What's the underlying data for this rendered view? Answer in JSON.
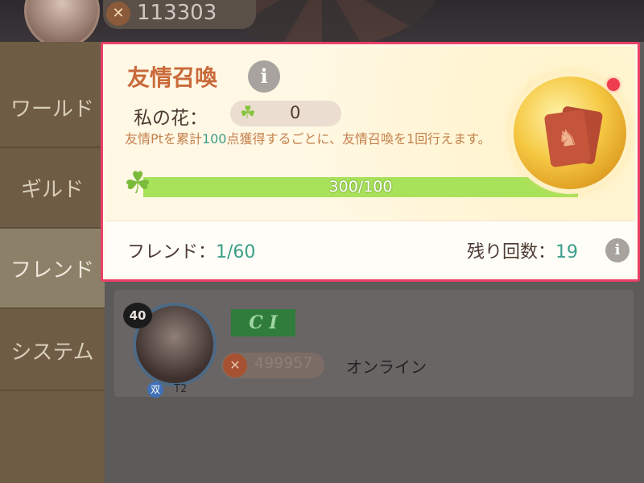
{
  "top": {
    "player_power": "113303"
  },
  "sidebar": {
    "items": [
      {
        "label": "ワールド"
      },
      {
        "label": "ギルド"
      },
      {
        "label": "フレンド"
      },
      {
        "label": "システム"
      }
    ]
  },
  "panel": {
    "title": "友情召喚",
    "flower_label": "私の花：",
    "flower_count": "0",
    "desc_before": "友情Ptを累計",
    "desc_num": "100",
    "desc_after": "点獲得するごとに、友情召喚を1回行えます。",
    "progress_text": "300/100",
    "progress_fraction": 1.0,
    "friends_label": "フレンド：",
    "friends_value": "1/60",
    "remain_label": "残り回数：",
    "remain_value": "19"
  },
  "friend": {
    "level": "40",
    "tag": "C I",
    "power": "499957",
    "status": "オンライン",
    "rank_badge": "双",
    "rank_text": "T2"
  },
  "colors": {
    "highlight_border": "#e94068",
    "accent_text": "#3b9e88",
    "title_orange": "#c96a3a"
  }
}
